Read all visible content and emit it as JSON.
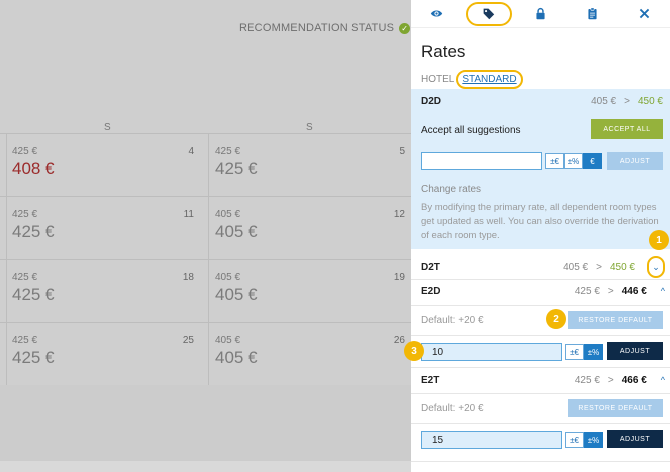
{
  "calendar": {
    "recommendation_status": "RECOMMENDATION STATUS",
    "col1_head": "S",
    "col2_head": "S",
    "rows": [
      {
        "c1": {
          "base": "425 €",
          "price": "408 €",
          "date": "4",
          "highlight": true
        },
        "c2": {
          "base": "425 €",
          "price": "425 €",
          "date": "5"
        }
      },
      {
        "c1": {
          "base": "425 €",
          "price": "425 €",
          "date": "11"
        },
        "c2": {
          "base": "405 €",
          "price": "405 €",
          "date": "12"
        }
      },
      {
        "c1": {
          "base": "425 €",
          "price": "425 €",
          "date": "18"
        },
        "c2": {
          "base": "405 €",
          "price": "405 €",
          "date": "19"
        }
      },
      {
        "c1": {
          "base": "425 €",
          "price": "425 €",
          "date": "25"
        },
        "c2": {
          "base": "405 €",
          "price": "405 €",
          "date": "26"
        }
      }
    ]
  },
  "tabs": [
    {
      "icon": "eye-icon"
    },
    {
      "icon": "tag-icon",
      "active": true
    },
    {
      "icon": "lock-icon"
    },
    {
      "icon": "clipboard-icon"
    },
    {
      "icon": "close-icon"
    }
  ],
  "panel": {
    "title": "Rates",
    "hotel_label": "HOTEL",
    "standard_link": "STANDARD",
    "d2d": {
      "name": "D2D",
      "old": "405 €",
      "arrow": ">",
      "new": "450 €",
      "accept_label": "Accept all suggestions",
      "accept_button": "ACCEPT ALL",
      "input_value": "",
      "toggle_euro": "±€",
      "toggle_pct": "±%",
      "toggle_abs": "€",
      "adjust_button": "ADJUST",
      "change_label": "Change rates",
      "change_desc": "By modifying the primary rate, all dependent room types get updated as well. You can also override the derivation of each room type."
    },
    "d2t": {
      "name": "D2T",
      "old": "405 €",
      "arrow": ">",
      "new": "450 €"
    },
    "e2d": {
      "name": "E2D",
      "old": "425 €",
      "arrow": ">",
      "new": "446 €",
      "default_label": "Default: +20 €",
      "restore_button": "RESTORE DEFAULT",
      "input_value": "10",
      "toggle_euro": "±€",
      "toggle_pct": "±%",
      "adjust_button": "ADJUST"
    },
    "e2t": {
      "name": "E2T",
      "old": "425 €",
      "arrow": ">",
      "new": "466 €",
      "default_label": "Default: +20 €",
      "restore_button": "RESTORE DEFAULT",
      "input_value": "15",
      "toggle_euro": "±€",
      "toggle_pct": "±%",
      "adjust_button": "ADJUST"
    },
    "badges": [
      "1",
      "2",
      "3"
    ]
  },
  "colors": {
    "accent_yellow": "#f2b705",
    "green": "#7fa531",
    "navy": "#0e2a48",
    "link_blue": "#1f6fb4",
    "price_red": "#9b2b2b"
  }
}
